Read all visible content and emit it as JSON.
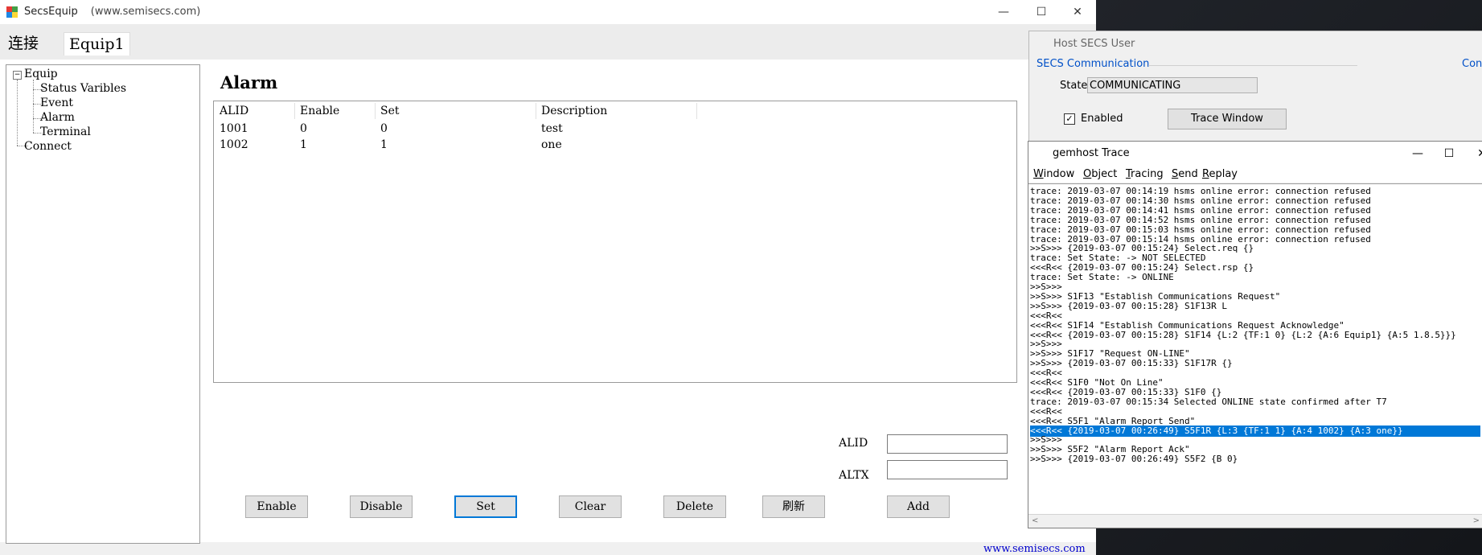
{
  "main": {
    "title": "SecsEquip",
    "title_url": "(www.semisecs.com)",
    "window_controls": {
      "minimize": "—",
      "maximize": "☐",
      "close": "✕"
    },
    "tabs": [
      {
        "label": "连接"
      },
      {
        "label": "Equip1"
      }
    ],
    "tree": {
      "root": "Equip",
      "root_expander": "−",
      "children": [
        "Status Varibles",
        "Event",
        "Alarm",
        "Terminal"
      ],
      "second_root": "Connect"
    },
    "section_title": "Alarm",
    "alarm_table": {
      "headers": [
        "ALID",
        "Enable",
        "Set",
        "Description"
      ],
      "rows": [
        [
          "1001",
          "0",
          "0",
          "test"
        ],
        [
          "1002",
          "1",
          "1",
          "one"
        ]
      ]
    },
    "form": {
      "alid_label": "ALID",
      "altx_label": "ALTX",
      "alid_value": "",
      "altx_value": ""
    },
    "buttons": {
      "enable": "Enable",
      "disable": "Disable",
      "set": "Set",
      "clear": "Clear",
      "delete": "Delete",
      "refresh": "刷新",
      "add": "Add"
    },
    "bottom_url": "www.semisecs.com"
  },
  "host": {
    "title": "Host SECS User",
    "group_caption": "SECS Communication",
    "group_caption_right": "Cont",
    "state_label": "State:",
    "state_value": "COMMUNICATING",
    "enabled_label": "Enabled",
    "enabled_check": "✓",
    "trace_button": "Trace Window"
  },
  "trace": {
    "title": "gemhost Trace",
    "window_controls": {
      "minimize": "—",
      "maximize": "☐",
      "close": "✕"
    },
    "menu": [
      {
        "first": "W",
        "rest": "indow"
      },
      {
        "first": "O",
        "rest": "bject"
      },
      {
        "first": "T",
        "rest": "racing"
      },
      {
        "first": "S",
        "rest": "end"
      },
      {
        "first": "R",
        "rest": "eplay"
      }
    ],
    "lines": [
      "trace: 2019-03-07 00:14:19 hsms online error: connection refused",
      "trace: 2019-03-07 00:14:30 hsms online error: connection refused",
      "trace: 2019-03-07 00:14:41 hsms online error: connection refused",
      "trace: 2019-03-07 00:14:52 hsms online error: connection refused",
      "trace: 2019-03-07 00:15:03 hsms online error: connection refused",
      "trace: 2019-03-07 00:15:14 hsms online error: connection refused",
      ">>S>>> {2019-03-07 00:15:24} Select.req {}",
      "trace: Set State: -> NOT SELECTED",
      "<<<R<< {2019-03-07 00:15:24} Select.rsp {}",
      "trace: Set State: -> ONLINE",
      ">>S>>>",
      ">>S>>> S1F13 \"Establish Communications Request\"",
      ">>S>>> {2019-03-07 00:15:28} S1F13R L",
      "<<<R<<",
      "<<<R<< S1F14 \"Establish Communications Request Acknowledge\"",
      "<<<R<< {2019-03-07 00:15:28} S1F14 {L:2 {TF:1 0} {L:2 {A:6 Equip1} {A:5 1.8.5}}}",
      ">>S>>>",
      ">>S>>> S1F17 \"Request ON-LINE\"",
      ">>S>>> {2019-03-07 00:15:33} S1F17R {}",
      "<<<R<<",
      "<<<R<< S1F0 \"Not On Line\"",
      "<<<R<< {2019-03-07 00:15:33} S1F0 {}",
      "trace: 2019-03-07 00:15:34 Selected ONLINE state confirmed after T7",
      "<<<R<<",
      "<<<R<< S5F1 \"Alarm Report Send\"",
      "<<<R<< {2019-03-07 00:26:49} S5F1R {L:3 {TF:1 1} {A:4 1002} {A:3 one}}",
      ">>S>>>",
      ">>S>>> S5F2 \"Alarm Report Ack\"",
      ">>S>>> {2019-03-07 00:26:49} S5F2 {B 0}"
    ],
    "selected_index": 25,
    "scroll_left": "<",
    "scroll_right": ">"
  }
}
